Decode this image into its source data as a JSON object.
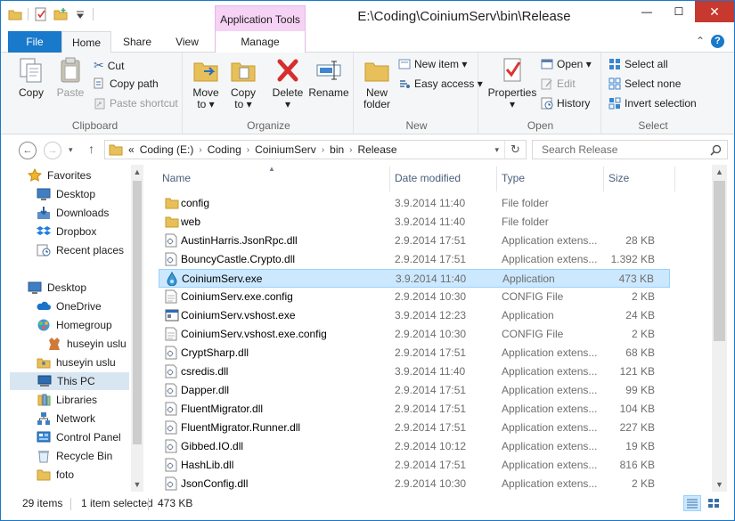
{
  "window": {
    "title": "E:\\Coding\\CoiniumServ\\bin\\Release",
    "context_tab_header": "Application Tools",
    "controls": {
      "minimize": "—",
      "maximize": "☐",
      "close": "✕"
    }
  },
  "ribbon_tabs": {
    "file": "File",
    "home": "Home",
    "share": "Share",
    "view": "View",
    "manage": "Manage"
  },
  "ribbon": {
    "clipboard": {
      "label": "Clipboard",
      "copy": "Copy",
      "paste": "Paste",
      "cut": "Cut",
      "copy_path": "Copy path",
      "paste_shortcut": "Paste shortcut"
    },
    "organize": {
      "label": "Organize",
      "move_to": "Move",
      "move_to2": "to ▾",
      "copy_to": "Copy",
      "copy_to2": "to ▾",
      "delete": "Delete",
      "delete2": "▾",
      "rename": "Rename"
    },
    "new": {
      "label": "New",
      "new_folder": "New",
      "new_folder2": "folder",
      "new_item": "New item ▾",
      "easy_access": "Easy access ▾"
    },
    "open": {
      "label": "Open",
      "properties": "Properties",
      "properties2": "▾",
      "open": "Open ▾",
      "edit": "Edit",
      "history": "History"
    },
    "select": {
      "label": "Select",
      "select_all": "Select all",
      "select_none": "Select none",
      "invert": "Invert selection"
    }
  },
  "address": {
    "prefix": "«",
    "crumbs": [
      "Coding (E:)",
      "Coding",
      "CoiniumServ",
      "bin",
      "Release"
    ],
    "search_placeholder": "Search Release"
  },
  "nav_pane": [
    {
      "label": "Favorites",
      "icon": "star-icon",
      "indent": 0,
      "id": "favorites"
    },
    {
      "label": "Desktop",
      "icon": "desktop-icon",
      "indent": 1,
      "id": "desktop-fav"
    },
    {
      "label": "Downloads",
      "icon": "downloads-icon",
      "indent": 1,
      "id": "downloads"
    },
    {
      "label": "Dropbox",
      "icon": "dropbox-icon",
      "indent": 1,
      "id": "dropbox"
    },
    {
      "label": "Recent places",
      "icon": "recent-places-icon",
      "indent": 1,
      "id": "recent-places"
    },
    {
      "label": "Desktop",
      "icon": "desktop-icon",
      "indent": 0,
      "id": "desktop"
    },
    {
      "label": "OneDrive",
      "icon": "onedrive-icon",
      "indent": 1,
      "id": "onedrive"
    },
    {
      "label": "Homegroup",
      "icon": "homegroup-icon",
      "indent": 1,
      "id": "homegroup"
    },
    {
      "label": "huseyin uslu",
      "icon": "user-icon",
      "indent": 2,
      "id": "homegroup-user"
    },
    {
      "label": "huseyin uslu",
      "icon": "user-folder-icon",
      "indent": 1,
      "id": "user-folder"
    },
    {
      "label": "This PC",
      "icon": "computer-icon",
      "indent": 1,
      "id": "this-pc",
      "selected": true
    },
    {
      "label": "Libraries",
      "icon": "libraries-icon",
      "indent": 1,
      "id": "libraries"
    },
    {
      "label": "Network",
      "icon": "network-icon",
      "indent": 1,
      "id": "network"
    },
    {
      "label": "Control Panel",
      "icon": "control-panel-icon",
      "indent": 1,
      "id": "control-panel"
    },
    {
      "label": "Recycle Bin",
      "icon": "recycle-bin-icon",
      "indent": 1,
      "id": "recycle-bin"
    },
    {
      "label": "foto",
      "icon": "folder-icon",
      "indent": 1,
      "id": "foto"
    }
  ],
  "columns": {
    "name": "Name",
    "date": "Date modified",
    "type": "Type",
    "size": "Size"
  },
  "files": [
    {
      "name": "config",
      "date": "3.9.2014 11:40",
      "type": "File folder",
      "size": "",
      "icon": "folder-icon"
    },
    {
      "name": "web",
      "date": "3.9.2014 11:40",
      "type": "File folder",
      "size": "",
      "icon": "folder-icon"
    },
    {
      "name": "AustinHarris.JsonRpc.dll",
      "date": "2.9.2014 17:51",
      "type": "Application extens...",
      "size": "28 KB",
      "icon": "dll-icon"
    },
    {
      "name": "BouncyCastle.Crypto.dll",
      "date": "2.9.2014 17:51",
      "type": "Application extens...",
      "size": "1.392 KB",
      "icon": "dll-icon"
    },
    {
      "name": "CoiniumServ.exe",
      "date": "3.9.2014 11:40",
      "type": "Application",
      "size": "473 KB",
      "icon": "coinium-exe-icon",
      "selected": true
    },
    {
      "name": "CoiniumServ.exe.config",
      "date": "2.9.2014 10:30",
      "type": "CONFIG File",
      "size": "2 KB",
      "icon": "config-file-icon"
    },
    {
      "name": "CoiniumServ.vshost.exe",
      "date": "3.9.2014 12:23",
      "type": "Application",
      "size": "24 KB",
      "icon": "exe-icon"
    },
    {
      "name": "CoiniumServ.vshost.exe.config",
      "date": "2.9.2014 10:30",
      "type": "CONFIG File",
      "size": "2 KB",
      "icon": "config-file-icon"
    },
    {
      "name": "CryptSharp.dll",
      "date": "2.9.2014 17:51",
      "type": "Application extens...",
      "size": "68 KB",
      "icon": "dll-icon"
    },
    {
      "name": "csredis.dll",
      "date": "3.9.2014 11:40",
      "type": "Application extens...",
      "size": "121 KB",
      "icon": "dll-icon"
    },
    {
      "name": "Dapper.dll",
      "date": "2.9.2014 17:51",
      "type": "Application extens...",
      "size": "99 KB",
      "icon": "dll-icon"
    },
    {
      "name": "FluentMigrator.dll",
      "date": "2.9.2014 17:51",
      "type": "Application extens...",
      "size": "104 KB",
      "icon": "dll-icon"
    },
    {
      "name": "FluentMigrator.Runner.dll",
      "date": "2.9.2014 17:51",
      "type": "Application extens...",
      "size": "227 KB",
      "icon": "dll-icon"
    },
    {
      "name": "Gibbed.IO.dll",
      "date": "2.9.2014 10:12",
      "type": "Application extens...",
      "size": "19 KB",
      "icon": "dll-icon"
    },
    {
      "name": "HashLib.dll",
      "date": "2.9.2014 17:51",
      "type": "Application extens...",
      "size": "816 KB",
      "icon": "dll-icon"
    },
    {
      "name": "JsonConfig.dll",
      "date": "2.9.2014 10:30",
      "type": "Application extens...",
      "size": "2 KB",
      "icon": "dll-icon"
    }
  ],
  "status": {
    "items": "29 items",
    "selected": "1 item selected",
    "selected_size": "473 KB"
  },
  "colors": {
    "accent": "#1979ca",
    "selection": "#cce8ff",
    "selection_border": "#99d1ff",
    "context_tab": "#f6d2f5",
    "close": "#c7382e"
  }
}
